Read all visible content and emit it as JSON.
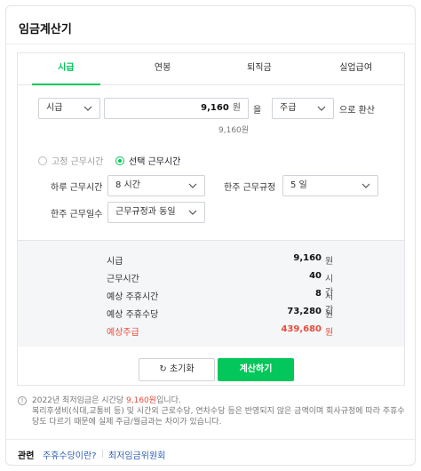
{
  "title": "임금계산기",
  "tabs": [
    {
      "label": "시급",
      "active": true
    },
    {
      "label": "연봉",
      "active": false
    },
    {
      "label": "퇴직금",
      "active": false
    },
    {
      "label": "실업급여",
      "active": false
    }
  ],
  "wage_input": {
    "type_select": "시급",
    "amount": "9,160",
    "amount_unit": "원",
    "particle": "을",
    "period_select": "주급",
    "suffix": "으로 환산",
    "amount_hint": "9,160원"
  },
  "work_time_mode": {
    "fixed_label": "고정 근무시간",
    "select_label": "선택 근무시간",
    "selected": "선택 근무시간"
  },
  "fields": {
    "daily_hours_label": "하루 근무시간",
    "daily_hours_value": "8 시간",
    "weekly_rule_label": "한주 근무규정",
    "weekly_rule_value": "5 일",
    "weekly_days_label": "한주 근무일수",
    "weekly_days_value": "근무규정과 동일"
  },
  "results": [
    {
      "label": "시급",
      "value": "9,160",
      "unit": "원"
    },
    {
      "label": "근무시간",
      "value": "40",
      "unit": "시간"
    },
    {
      "label": "예상 주휴시간",
      "value": "8",
      "unit": "시간"
    },
    {
      "label": "예상 주휴수당",
      "value": "73,280",
      "unit": "원"
    },
    {
      "label": "예상주급",
      "value": "439,680",
      "unit": "원"
    }
  ],
  "buttons": {
    "reset": "초기화",
    "calculate": "계산하기"
  },
  "note": {
    "line1_prefix": "2022년 최저임금은 시간당 ",
    "line1_highlight": "9,160원",
    "line1_suffix": "입니다.",
    "line2": "복리후생비(식대,교통비 등) 및 시간외 근로수당, 연차수당 등은 반영되지 않은 금액이며 회사규정에 따라 주휴수당도 다르기 때문에 실제 주급/월급과는 차이가 있습니다."
  },
  "related": {
    "label": "관련",
    "links": [
      "주휴수당이란?",
      "최저임금위원회"
    ]
  },
  "colors": {
    "accent": "#03c75a",
    "highlight": "#e74c3c",
    "link": "#2d5eb3"
  }
}
